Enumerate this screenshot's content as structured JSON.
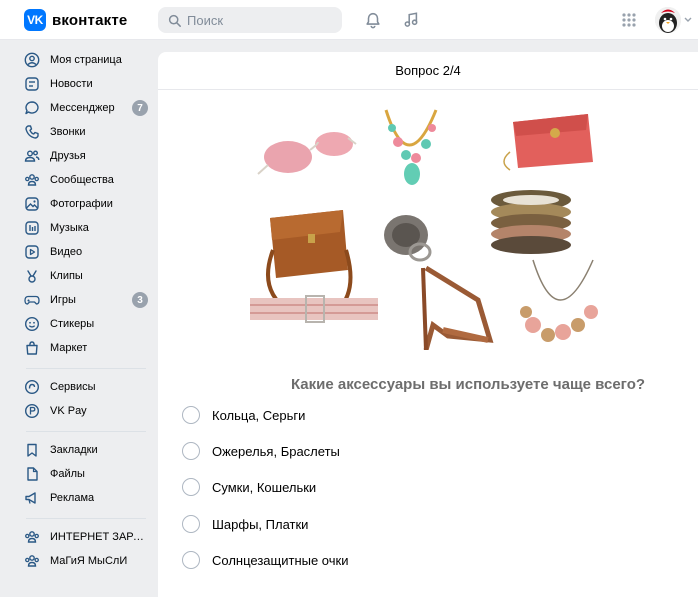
{
  "header": {
    "logo_mark": "VK",
    "logo_text": "вконтакте",
    "search_placeholder": "Поиск",
    "icons": [
      "bell-icon",
      "music-icon",
      "apps-grid-icon"
    ]
  },
  "sidebar": {
    "items": [
      {
        "label": "Моя страница",
        "icon": "user-circle-icon"
      },
      {
        "label": "Новости",
        "icon": "newsfeed-icon"
      },
      {
        "label": "Мессенджер",
        "icon": "message-icon",
        "badge": "7"
      },
      {
        "label": "Звонки",
        "icon": "phone-icon"
      },
      {
        "label": "Друзья",
        "icon": "friends-icon"
      },
      {
        "label": "Сообщества",
        "icon": "communities-icon"
      },
      {
        "label": "Фотографии",
        "icon": "photo-icon"
      },
      {
        "label": "Музыка",
        "icon": "music-icon"
      },
      {
        "label": "Видео",
        "icon": "video-icon"
      },
      {
        "label": "Клипы",
        "icon": "clips-icon"
      },
      {
        "label": "Игры",
        "icon": "gamepad-icon",
        "badge": "3"
      },
      {
        "label": "Стикеры",
        "icon": "smile-icon"
      },
      {
        "label": "Маркет",
        "icon": "market-bag-icon"
      }
    ],
    "items2": [
      {
        "label": "Сервисы",
        "icon": "services-icon"
      },
      {
        "label": "VK Pay",
        "icon": "vkpay-icon"
      }
    ],
    "items3": [
      {
        "label": "Закладки",
        "icon": "bookmark-icon"
      },
      {
        "label": "Файлы",
        "icon": "file-icon"
      },
      {
        "label": "Реклама",
        "icon": "megaphone-icon"
      }
    ],
    "items4": [
      {
        "label": "ИНТЕРНЕТ ЗАРАБ...",
        "icon": "group-icon"
      },
      {
        "label": "МаГиЯ МыСлИ",
        "icon": "group-icon"
      }
    ]
  },
  "quiz": {
    "title": "Вопрос 2/4",
    "question": "Какие аксессуары вы используете чаще всего?",
    "options": [
      "Кольца, Серьги",
      "Ожерелья, Браслеты",
      "Сумки, Кошельки",
      "Шарфы, Платки",
      "Солнцезащитные очки"
    ]
  },
  "colors": {
    "brand": "#0077ff",
    "background": "#edeef0",
    "badge": "#99a2ad",
    "icon": "#2a5885"
  }
}
